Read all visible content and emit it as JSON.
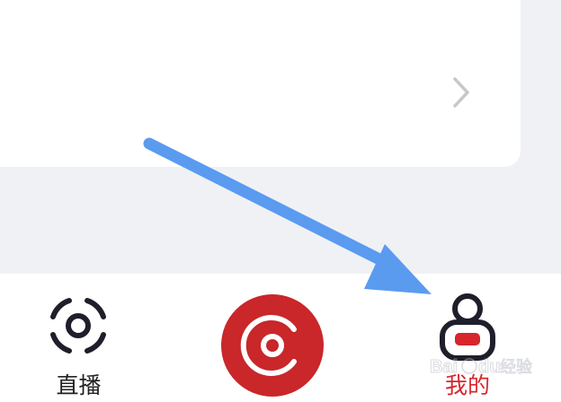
{
  "card": {
    "chevron_icon": "chevron-right-icon"
  },
  "tabbar": {
    "tabs": [
      {
        "label": "直播",
        "icon": "live-scan-icon",
        "active": false
      },
      {
        "label": "",
        "icon": "center-logo-icon",
        "active": false
      },
      {
        "label": "我的",
        "icon": "profile-icon",
        "active": true
      }
    ]
  },
  "overlay": {
    "annotation": "blue-arrow-pointer",
    "watermark": "Baidu 经验"
  },
  "colors": {
    "background": "#f0f1f5",
    "card": "#ffffff",
    "accent_red": "#d7262c",
    "icon_dark": "#1f1f2b",
    "arrow_blue": "#5a9bf0"
  }
}
